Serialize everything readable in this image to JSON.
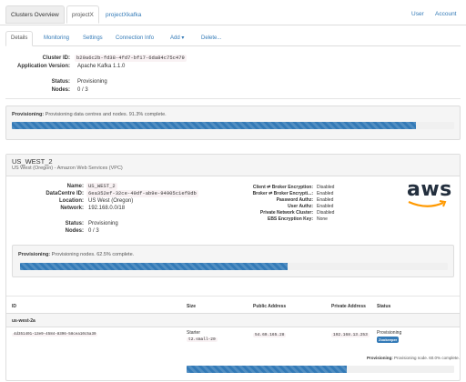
{
  "topnav": {
    "tabs": [
      "Clusters Overview",
      "projectX",
      "projectXkafka"
    ],
    "right": [
      "User",
      "Account"
    ]
  },
  "subtabs": [
    "Details",
    "Monitoring",
    "Settings",
    "Connection Info",
    "Add ▾",
    "Delete..."
  ],
  "cluster": {
    "id_label": "Cluster ID:",
    "id": "b29a6c2b-fd38-4fd7-bf17-6da84c75c479",
    "version_label": "Application Version:",
    "version": "Apache Kafka 1.1.0",
    "status_label": "Status:",
    "status": "Provisioning",
    "nodes_label": "Nodes:",
    "nodes": "0 / 3"
  },
  "cluster_progress": {
    "title": "Provisioning:",
    "text": "Provisioning data centres and nodes. 91.3% complete.",
    "percent": 91.3
  },
  "datacentre": {
    "name": "US_WEST_2",
    "subtitle": "US West (Oregon) - Amazon Web Services (VPC)",
    "name_label": "Name:",
    "name_value": "US_WEST_2",
    "id_label": "DataCentre ID:",
    "id": "6ea352ef-32ce-49df-ab9e-94905c1ef8db",
    "location_label": "Location:",
    "location": "US West (Oregon)",
    "network_label": "Network:",
    "network": "192.168.0.0/18",
    "status_label": "Status:",
    "status": "Provisioning",
    "nodes_label": "Nodes:",
    "nodes": "0 / 3",
    "security": [
      {
        "k": "Client ⇌ Broker Encryption:",
        "v": "Disabled"
      },
      {
        "k": "Broker ⇌ Broker Encrypti...:",
        "v": "Enabled"
      },
      {
        "k": "Password Authz:",
        "v": "Enabled"
      },
      {
        "k": "User Authz:",
        "v": "Enabled"
      },
      {
        "k": "Private Network Cluster:",
        "v": "Disabled"
      },
      {
        "k": "EBS Encryption Key:",
        "v": "None"
      }
    ],
    "logo_text": "aws",
    "logo_color": "#232f3e",
    "logo_accent": "#ff9900"
  },
  "dc_progress": {
    "title": "Provisioning:",
    "text": "Provisioning nodes. 62.5% complete.",
    "percent": 62.5
  },
  "nodes_table": {
    "headers": [
      "ID",
      "Size",
      "Public Address",
      "Private Address",
      "Status"
    ],
    "rack": "us-west-2a",
    "row": {
      "id": "4d351401-13e9-4584-8396-58cea10c5a39",
      "size_top": "Starter",
      "size_code": "t2.small-20",
      "public": "54.69.165.28",
      "private": "192.168.13.253",
      "status": "Provisioning",
      "badge": "Zookeeper"
    }
  },
  "node_progress": {
    "title": "Provisioning:",
    "text": "Provisioning node. 60.0% complete.",
    "percent": 60.0
  },
  "colors": {
    "accent": "#337ab7",
    "code": "#c7254e"
  }
}
